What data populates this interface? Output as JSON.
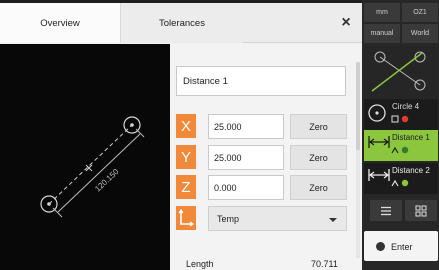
{
  "dialog": {
    "tabs": [
      {
        "label": "Overview",
        "active": true
      },
      {
        "label": "Tolerances",
        "active": false
      }
    ],
    "close_glyph": "×",
    "preview": {
      "dimension_text": "120.150"
    },
    "name_value": "Distance 1",
    "axes": [
      {
        "axis": "X",
        "value": "25.000",
        "zero_label": "Zero"
      },
      {
        "axis": "Y",
        "value": "25.000",
        "zero_label": "Zero"
      },
      {
        "axis": "Z",
        "value": "0.000",
        "zero_label": "Zero"
      }
    ],
    "reference_system": "Temp",
    "length_label": "Length",
    "length_value": "70.711"
  },
  "right_panel": {
    "top_grid": [
      "mm",
      "OZ1",
      "manual",
      "World"
    ],
    "features": [
      {
        "label": "Circle 4",
        "icon": "circle-feature-icon",
        "selected": false
      },
      {
        "label": "Distance 1",
        "icon": "distance-feature-icon",
        "selected": true
      },
      {
        "label": "Distance 2",
        "icon": "distance-feature-icon",
        "selected": false
      }
    ],
    "tools": [
      {
        "icon": "menu-icon"
      },
      {
        "icon": "grid-icon"
      }
    ],
    "enter_label": "Enter"
  },
  "colors": {
    "accent_orange": "#f08a3a",
    "selected_green": "#8cc63f",
    "panel_dark": "#272727"
  }
}
